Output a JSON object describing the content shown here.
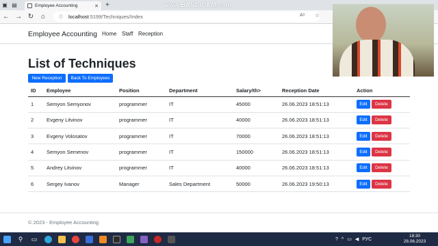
{
  "browser": {
    "tab_title": "Employee Accounting",
    "url_host": "localhost",
    "url_path": ":5199/Techniques/Index",
    "watermark": "www.BANDICAM.com",
    "reader_label": "Aᵃ"
  },
  "nav": {
    "brand": "Employee Accounting",
    "links": [
      "Home",
      "Staff",
      "Reception"
    ]
  },
  "page": {
    "title": "List of Techniques",
    "new_reception_label": "New Reception",
    "back_label": "Back To Employees"
  },
  "table": {
    "headers": [
      "ID",
      "Employee",
      "Position",
      "Department",
      "Salary/th>",
      "Reception Date",
      "Action"
    ],
    "rows": [
      {
        "id": "1",
        "employee": "Semyon Semyonov",
        "position": "programmer",
        "department": "IT",
        "salary": "45000",
        "date": "26.06.2023 18:51:13"
      },
      {
        "id": "2",
        "employee": "Evgeny Litvinov",
        "position": "programmer",
        "department": "IT",
        "salary": "40000",
        "date": "26.06.2023 18:51:13"
      },
      {
        "id": "3",
        "employee": "Evgeny Volosatov",
        "position": "programmer",
        "department": "IT",
        "salary": "70000",
        "date": "26.06.2023 18:51:13"
      },
      {
        "id": "4",
        "employee": "Semyon Semenov",
        "position": "programmer",
        "department": "IT",
        "salary": "150000",
        "date": "26.06.2023 18:51:13"
      },
      {
        "id": "5",
        "employee": "Andrey Litvinov",
        "position": "programmer",
        "department": "IT",
        "salary": "40000",
        "date": "26.06.2023 18:51:13"
      },
      {
        "id": "6",
        "employee": "Sergey Ivanov",
        "position": "Manager",
        "department": "Sales Department",
        "salary": "50000",
        "date": "26.06.2023 19:50:13"
      }
    ],
    "edit_label": "Edit",
    "delete_label": "Delete"
  },
  "footer": {
    "text": "© 2023 - Employee Accounting"
  },
  "taskbar": {
    "language": "РУС",
    "time": "18:30",
    "date": "28.06.2023"
  },
  "colors": {
    "primary": "#0d6efd",
    "danger": "#dc3545",
    "taskbar": "#1f2a44"
  },
  "icons": [
    "back-icon",
    "forward-icon",
    "refresh-icon",
    "home-icon",
    "lock-icon",
    "star-icon",
    "search-icon",
    "windows-icon"
  ]
}
